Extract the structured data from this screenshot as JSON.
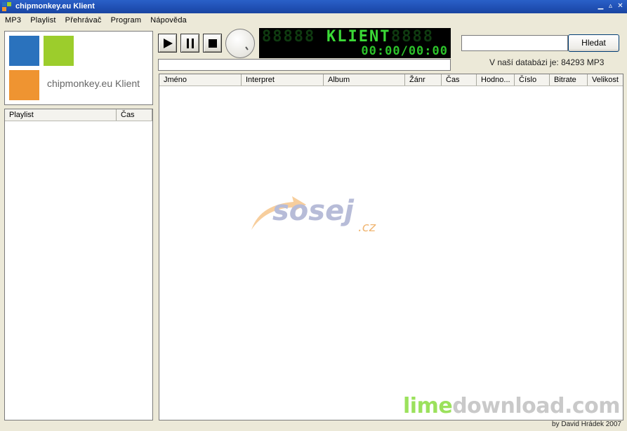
{
  "window": {
    "title": "chipmonkey.eu Klient"
  },
  "menu": {
    "items": [
      "MP3",
      "Playlist",
      "Přehrávač",
      "Program",
      "Nápověda"
    ]
  },
  "logo": {
    "text": "chipmonkey.eu Klient",
    "colors": {
      "blue": "#2a72bd",
      "green": "#9ccd2c",
      "orange": "#ef9431"
    }
  },
  "playlist": {
    "columns": [
      "Playlist",
      "Čas"
    ]
  },
  "player": {
    "lcd_text": "KLIENT",
    "lcd_time": "00:00/00:00",
    "buttons": {
      "play": "play-icon",
      "pause": "pause-icon",
      "stop": "stop-icon"
    }
  },
  "search": {
    "value": "",
    "button_label": "Hledat"
  },
  "database": {
    "info": "V naší databázi je: 84293 MP3"
  },
  "tracklist": {
    "columns": [
      "Jméno",
      "Interpret",
      "Album",
      "Žánr",
      "Čas",
      "Hodno...",
      "Číslo",
      "Bitrate",
      "Velikost"
    ]
  },
  "watermarks": {
    "sosej": "sosej",
    "sosej_tld": ".cz",
    "lime_a": "lime",
    "lime_b": "download.com"
  },
  "footer": {
    "author": "by David Hrádek 2007"
  }
}
